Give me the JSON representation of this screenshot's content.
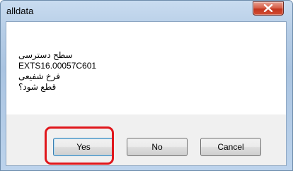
{
  "window": {
    "title": "alldata"
  },
  "message": {
    "lines": [
      "سطح دسترسی",
      "EXTS16.00057C601",
      "فرخ شفیعی",
      "قطع شود؟"
    ]
  },
  "buttons": {
    "yes": "Yes",
    "no": "No",
    "cancel": "Cancel"
  },
  "icons": {
    "close": "close-icon"
  },
  "colors": {
    "highlight": "#e0171c",
    "close_button": "#c3361f"
  }
}
